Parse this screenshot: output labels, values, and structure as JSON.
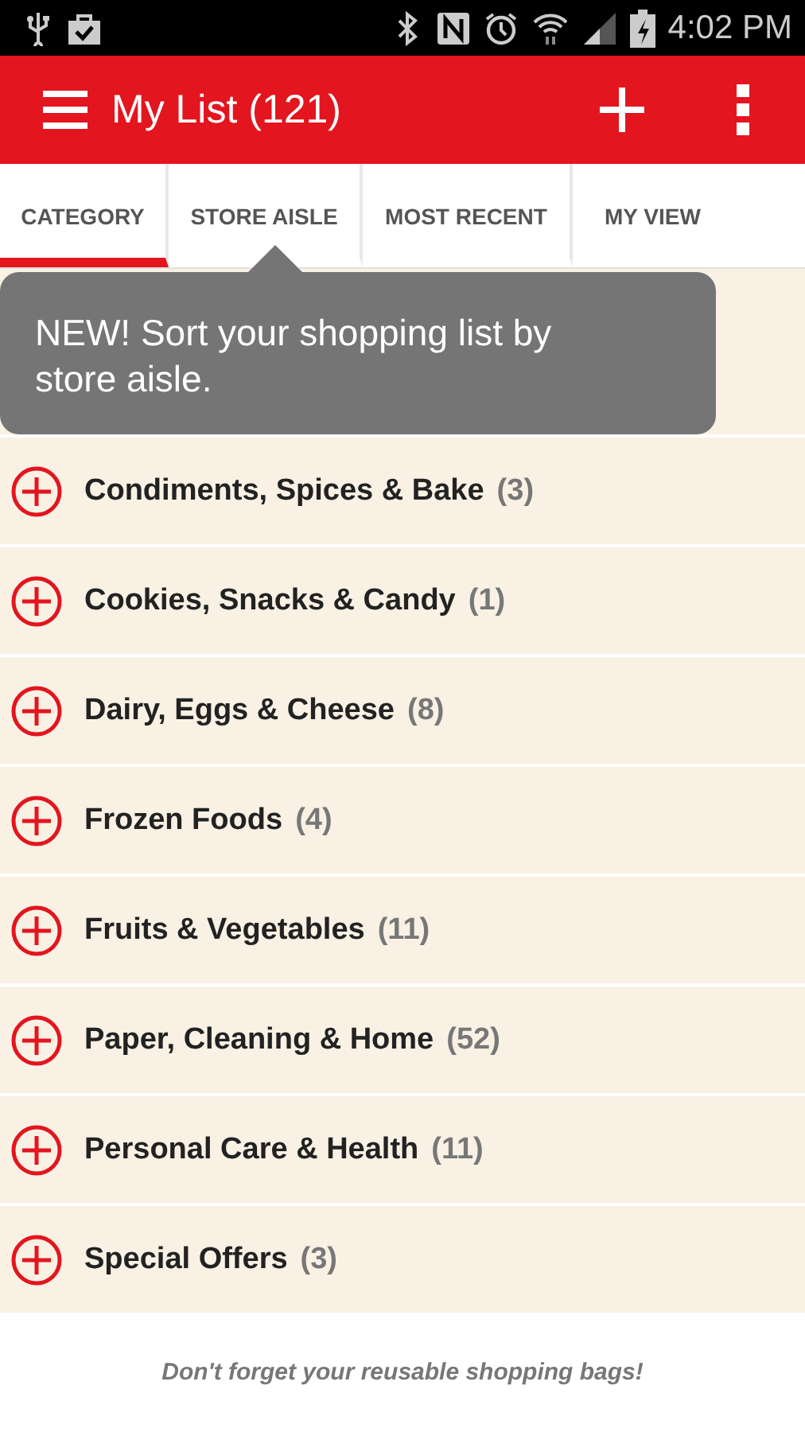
{
  "status_bar": {
    "time": "4:02 PM"
  },
  "app_bar": {
    "title": "My List (121)"
  },
  "tabs": [
    {
      "label": "CATEGORY",
      "selected": true
    },
    {
      "label": "STORE AISLE",
      "selected": false
    },
    {
      "label": "MOST RECENT",
      "selected": false
    },
    {
      "label": "MY VIEW",
      "selected": false
    }
  ],
  "tooltip": {
    "text": "NEW! Sort your shopping list by store aisle."
  },
  "categories": [
    {
      "name": "Condiments, Spices & Bake",
      "count": "(3)"
    },
    {
      "name": "Cookies, Snacks & Candy",
      "count": "(1)"
    },
    {
      "name": "Dairy, Eggs & Cheese",
      "count": "(8)"
    },
    {
      "name": "Frozen Foods",
      "count": "(4)"
    },
    {
      "name": "Fruits & Vegetables",
      "count": "(11)"
    },
    {
      "name": "Paper, Cleaning & Home",
      "count": "(52)"
    },
    {
      "name": "Personal Care & Health",
      "count": "(11)"
    },
    {
      "name": "Special Offers",
      "count": "(3)"
    }
  ],
  "footer": {
    "text": "Don't forget your reusable shopping bags!"
  }
}
